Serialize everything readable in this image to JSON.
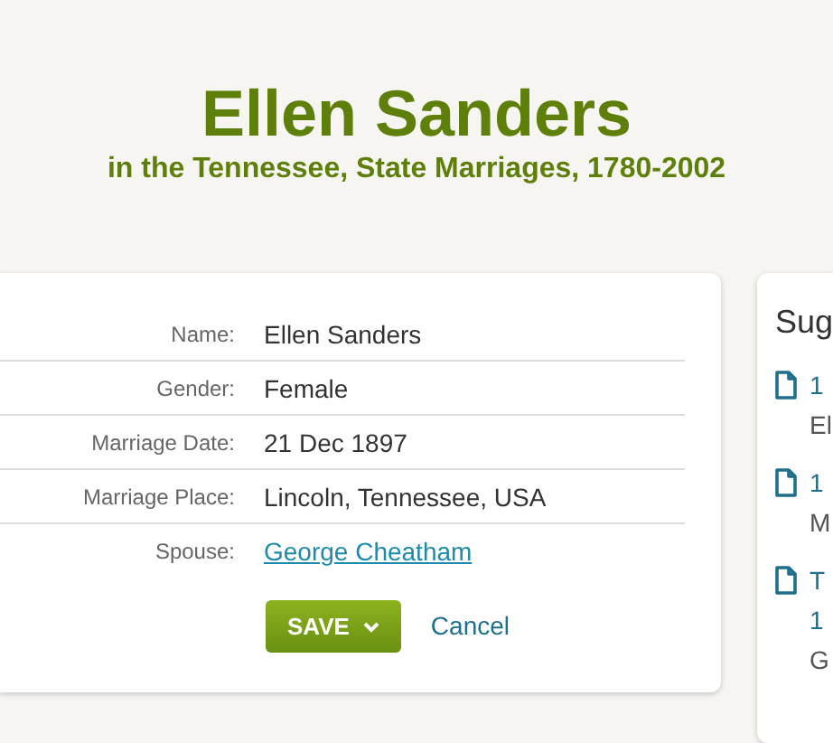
{
  "header": {
    "title": "Ellen Sanders",
    "subtitle": "in the Tennessee, State Marriages, 1780-2002"
  },
  "record": {
    "fields": [
      {
        "label": "Name:",
        "value": "Ellen Sanders",
        "kind": "text"
      },
      {
        "label": "Gender:",
        "value": "Female",
        "kind": "text"
      },
      {
        "label": "Marriage Date:",
        "value": "21 Dec 1897",
        "kind": "text"
      },
      {
        "label": "Marriage Place:",
        "value": "Lincoln, Tennessee, USA",
        "kind": "text"
      },
      {
        "label": "Spouse:",
        "value": "George Cheatham",
        "kind": "link"
      }
    ],
    "save_button": "SAVE",
    "cancel_link": "Cancel"
  },
  "sidebar": {
    "title": "Sug",
    "items": [
      {
        "title_lines": [
          "1"
        ],
        "subtitle": "El"
      },
      {
        "title_lines": [
          "1"
        ],
        "subtitle": "M"
      },
      {
        "title_lines": [
          "T",
          "1"
        ],
        "subtitle": "G"
      }
    ]
  }
}
